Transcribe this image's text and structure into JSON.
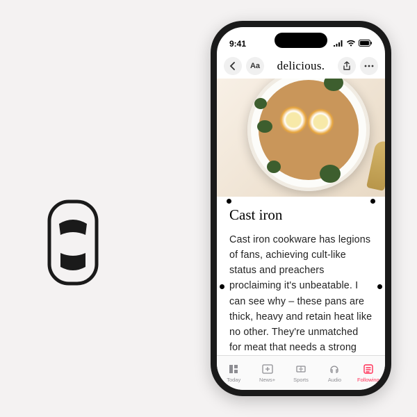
{
  "status": {
    "time": "9:41"
  },
  "nav": {
    "title": "delicious."
  },
  "article": {
    "title": "Cast iron",
    "body": "Cast iron cookware has legions of fans, achieving cult-like status and preachers proclaiming it's unbeatable. I can see why – these pans are thick, heavy and retain heat like no other. They're unmatched for meat that needs a strong sear: hav-"
  },
  "tabs": [
    {
      "label": "Today"
    },
    {
      "label": "News+"
    },
    {
      "label": "Sports"
    },
    {
      "label": "Audio"
    },
    {
      "label": "Following"
    }
  ]
}
